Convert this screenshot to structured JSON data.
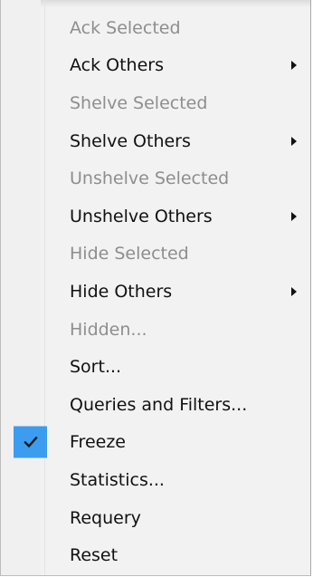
{
  "menu": {
    "items": [
      {
        "label": "Ack Selected",
        "enabled": false,
        "submenu": false,
        "checked": false
      },
      {
        "label": "Ack Others",
        "enabled": true,
        "submenu": true,
        "checked": false
      },
      {
        "label": "Shelve Selected",
        "enabled": false,
        "submenu": false,
        "checked": false
      },
      {
        "label": "Shelve Others",
        "enabled": true,
        "submenu": true,
        "checked": false
      },
      {
        "label": "Unshelve Selected",
        "enabled": false,
        "submenu": false,
        "checked": false
      },
      {
        "label": "Unshelve Others",
        "enabled": true,
        "submenu": true,
        "checked": false
      },
      {
        "label": "Hide Selected",
        "enabled": false,
        "submenu": false,
        "checked": false
      },
      {
        "label": "Hide Others",
        "enabled": true,
        "submenu": true,
        "checked": false
      },
      {
        "label": "Hidden...",
        "enabled": false,
        "submenu": false,
        "checked": false
      },
      {
        "label": "Sort...",
        "enabled": true,
        "submenu": false,
        "checked": false
      },
      {
        "label": "Queries and Filters...",
        "enabled": true,
        "submenu": false,
        "checked": false
      },
      {
        "label": "Freeze",
        "enabled": true,
        "submenu": false,
        "checked": true
      },
      {
        "label": "Statistics...",
        "enabled": true,
        "submenu": false,
        "checked": false
      },
      {
        "label": "Requery",
        "enabled": true,
        "submenu": false,
        "checked": false
      },
      {
        "label": "Reset",
        "enabled": true,
        "submenu": false,
        "checked": false
      }
    ]
  },
  "colors": {
    "menu_background": "#f2f2f2",
    "disabled_text": "#8e8e8e",
    "enabled_text": "#111111",
    "check_highlight": "#3c9cf0"
  },
  "icons": {
    "submenu": "submenu-arrow-icon",
    "check": "checkmark-icon"
  }
}
